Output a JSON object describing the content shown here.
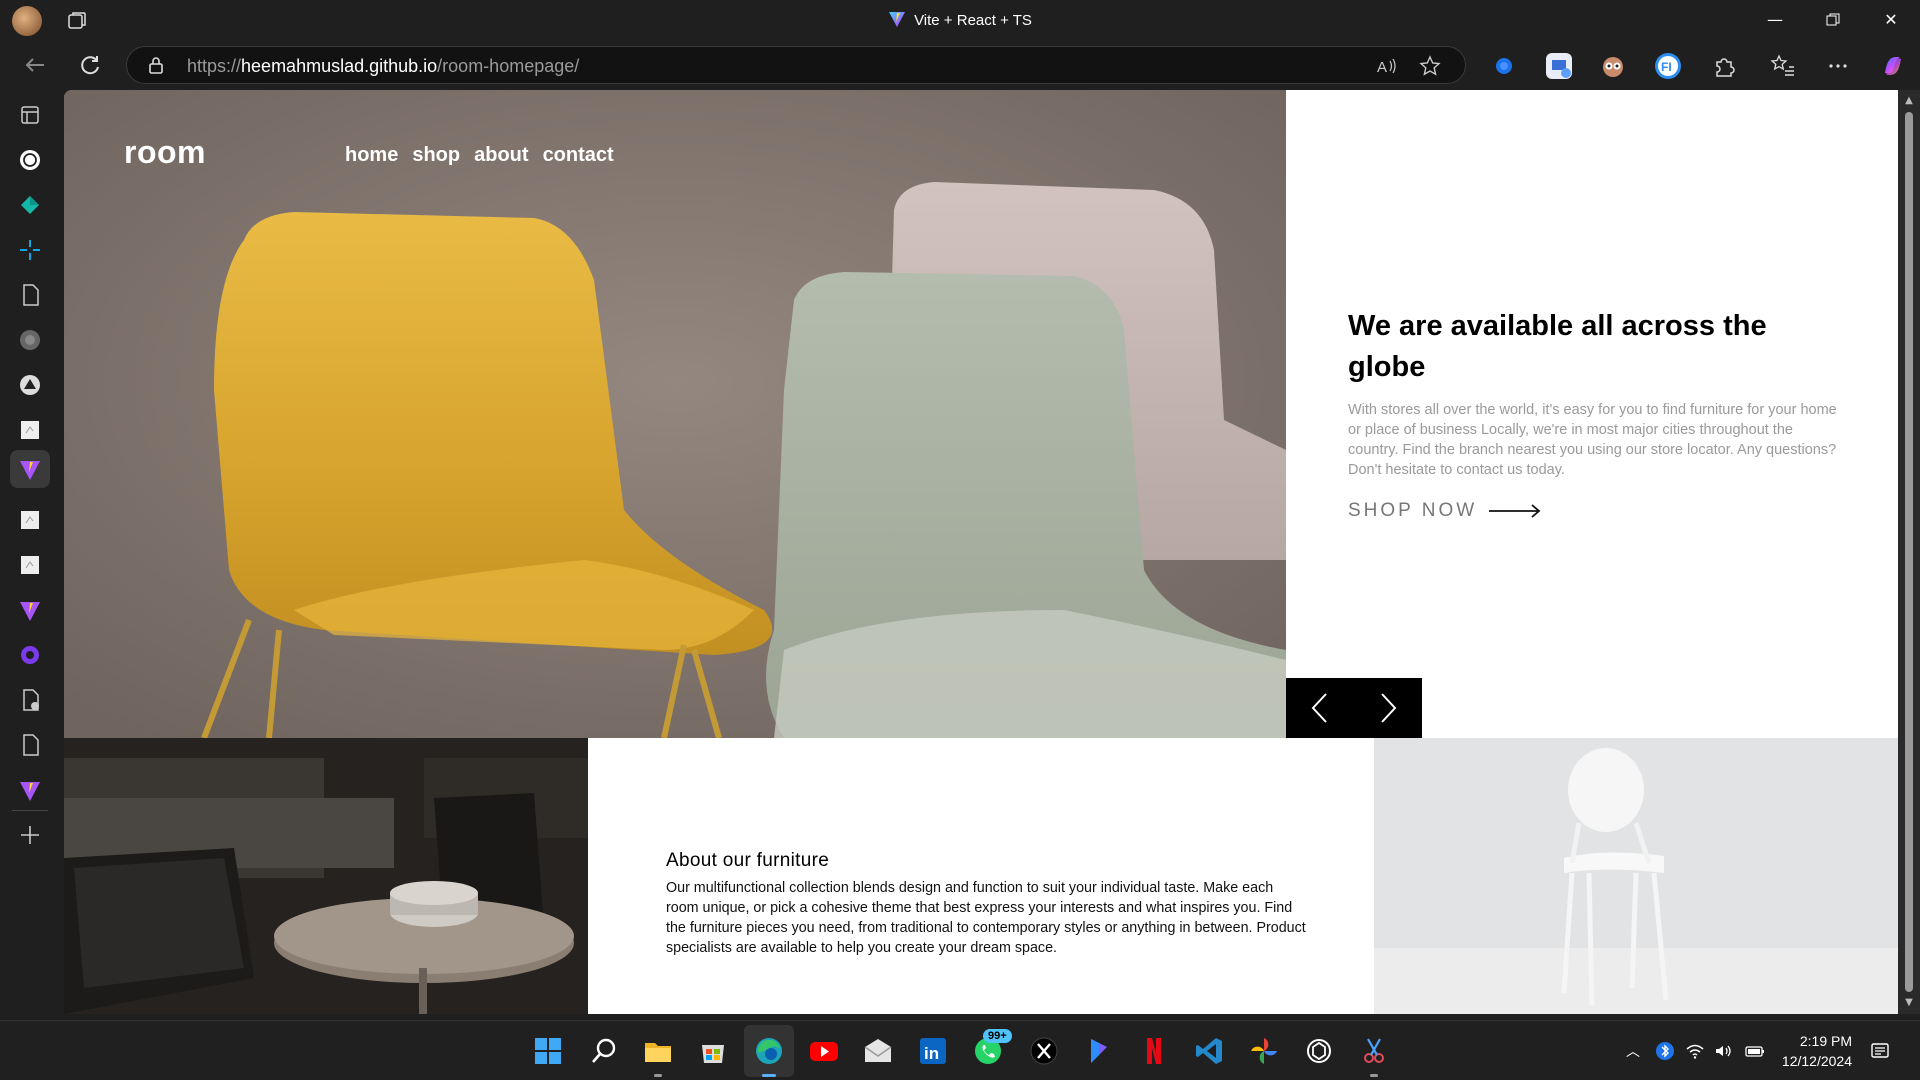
{
  "browser": {
    "window_title": "Vite + React + TS",
    "url_scheme": "https://",
    "url_host": "heemahmuslad.github.io",
    "url_path": "/room-homepage/"
  },
  "site": {
    "logo": "room",
    "nav": [
      "home",
      "shop",
      "about",
      "contact"
    ],
    "hero_heading": "We are available all across the globe",
    "hero_text": "With stores all over the world, it's easy for you to find furniture for your home or place of business Locally, we're in most major cities throughout the country. Find the branch nearest you using our store locator. Any questions? Don't hesitate to contact us today.",
    "shop_label": "SHOP NOW",
    "about_heading": "About our furniture",
    "about_text": "Our multifunctional collection blends design and function to suit your individual taste. Make each room unique, or pick a cohesive theme that best express your interests and what inspires you. Find the furniture pieces you need, from traditional to contemporary styles or anything in between. Product specialists are available to help you create your dream space."
  },
  "taskbar": {
    "whatsapp_badge": "99+",
    "time": "2:19 PM",
    "date": "12/12/2024"
  },
  "colors": {
    "accent_yellow": "#e2b43a",
    "chair_sage": "#a9b0a4",
    "chair_pink": "#cbbdb8"
  }
}
